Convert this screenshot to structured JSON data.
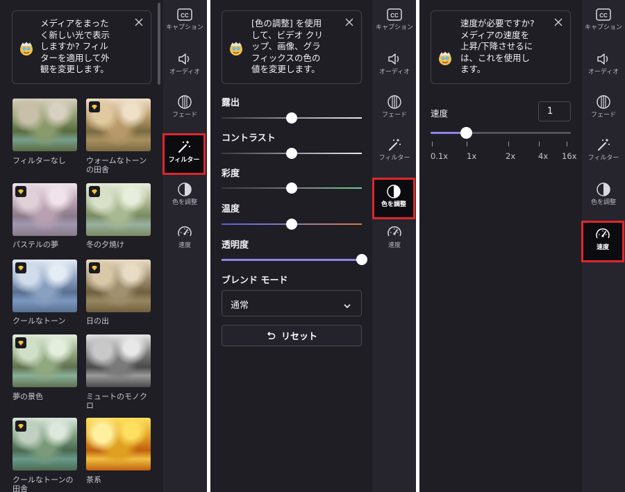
{
  "rail": {
    "items": [
      {
        "id": "captions",
        "label": "キャプション",
        "icon": "cc-icon"
      },
      {
        "id": "audio",
        "label": "オーディオ",
        "icon": "speaker-icon"
      },
      {
        "id": "fade",
        "label": "フェード",
        "icon": "fade-icon"
      },
      {
        "id": "filters",
        "label": "フィルター",
        "icon": "magic-wand-icon"
      },
      {
        "id": "adjust",
        "label": "色を調整",
        "icon": "contrast-icon"
      },
      {
        "id": "speed",
        "label": "速度",
        "icon": "speedometer-icon"
      }
    ]
  },
  "filters_panel": {
    "tip": "メディアをまったく新しい光で表示しますか? フィルターを適用して外観を変更します。",
    "tip_lines": [
      "メディアをまった",
      "く新しい光で表示",
      "しますか? フィル",
      "ターを適用して外",
      "観を変更します。"
    ],
    "active_item": "filters",
    "items": [
      {
        "label": "フィルターなし",
        "premium": false
      },
      {
        "label": "ウォームなトーンの田舎",
        "premium": true
      },
      {
        "label": "パステルの夢",
        "premium": true
      },
      {
        "label": "冬の夕焼け",
        "premium": true
      },
      {
        "label": "クールなトーン",
        "premium": true
      },
      {
        "label": "日の出",
        "premium": true
      },
      {
        "label": "夢の景色",
        "premium": true
      },
      {
        "label": "ミュートのモノクロ",
        "premium": false
      },
      {
        "label": "クールなトーンの田舎",
        "premium": true
      },
      {
        "label": "茶系",
        "premium": false
      }
    ]
  },
  "adjust_panel": {
    "tip_lines": [
      "[色の調整] を使用",
      "して、ビデオ クリ",
      "ップ、画像、グラ",
      "フィックスの色の",
      "値を変更します。"
    ],
    "active_item": "adjust",
    "sliders": [
      {
        "id": "exposure",
        "label": "露出",
        "value_fraction": 0.5
      },
      {
        "id": "contrast",
        "label": "コントラスト",
        "value_fraction": 0.5
      },
      {
        "id": "saturation",
        "label": "彩度",
        "value_fraction": 0.5
      },
      {
        "id": "temperature",
        "label": "温度",
        "value_fraction": 0.5
      },
      {
        "id": "transparency",
        "label": "透明度",
        "value_fraction": 1.0
      }
    ],
    "blend_mode_label": "ブレンド モード",
    "blend_mode_value": "通常",
    "reset_label": "リセット"
  },
  "speed_panel": {
    "tip_lines": [
      "速度が必要ですか?",
      "メディアの速度を",
      "上昇/下降させるに",
      "は、これを使用し",
      "ます。"
    ],
    "active_item": "speed",
    "speed_label": "速度",
    "speed_value": "1",
    "ticks": [
      "0.1x",
      "1x",
      "2x",
      "4x",
      "16x"
    ],
    "slider_value": "1x"
  },
  "colors": {
    "panel_bg": "#1f1e25",
    "rail_bg": "#26252d",
    "accent_slider": "#8f84e6",
    "highlight_red": "#e0262c",
    "saturation_gradient": [
      "#3a3940",
      "#6fd08a"
    ],
    "temperature_gradient": [
      "#5566d6",
      "#e07a3c"
    ]
  }
}
